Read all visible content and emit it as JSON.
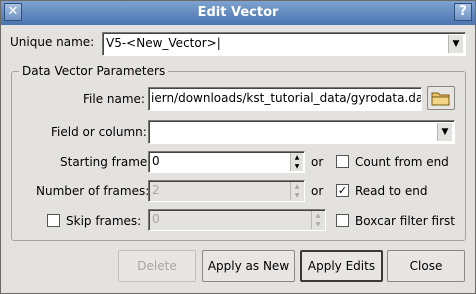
{
  "window": {
    "title": "Edit Vector",
    "left_control": "✕",
    "right_control": "?"
  },
  "unique_name": {
    "label": "Unique name:",
    "value": "V5-<New_Vector>"
  },
  "group": {
    "title": "Data Vector Parameters"
  },
  "file_name": {
    "label": "File name:",
    "value": "iern/downloads/kst_tutorial_data/gyrodata.dat"
  },
  "field": {
    "label": "Field or column:",
    "value": ""
  },
  "starting_frame": {
    "label": "Starting frame:",
    "value": "0",
    "or": "or"
  },
  "count_from_end": {
    "label": "Count from end",
    "checked": false
  },
  "num_frames": {
    "label": "Number of frames:",
    "value": "2",
    "or": "or"
  },
  "read_to_end": {
    "label": "Read to end",
    "checked": true,
    "mark": "✓"
  },
  "skip_frames": {
    "label": "Skip frames:",
    "checked": false,
    "value": "0"
  },
  "boxcar": {
    "label": "Boxcar filter first",
    "checked": false
  },
  "buttons": {
    "delete": "Delete",
    "apply_new": "Apply as New",
    "apply_edits": "Apply Edits",
    "close": "Close"
  },
  "icons": {
    "dropdown": "▼",
    "spin_up": "▲",
    "spin_down": "▼"
  }
}
